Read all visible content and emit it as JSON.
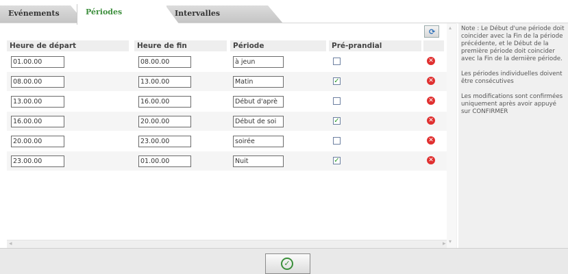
{
  "tabs": [
    {
      "label": "Evénements"
    },
    {
      "label": "Périodes"
    },
    {
      "label": "Intervalles"
    }
  ],
  "columns": {
    "start": "Heure de départ",
    "end": "Heure de fin",
    "period": "Période",
    "preprandial": "Pré-prandial"
  },
  "rows": [
    {
      "start": "01.00.00",
      "end": "08.00.00",
      "period": "à jeun",
      "preprandial": false
    },
    {
      "start": "08.00.00",
      "end": "13.00.00",
      "period": "Matin",
      "preprandial": true
    },
    {
      "start": "13.00.00",
      "end": "16.00.00",
      "period": "Début d'aprè",
      "preprandial": false
    },
    {
      "start": "16.00.00",
      "end": "20.00.00",
      "period": "Début de soi",
      "preprandial": true
    },
    {
      "start": "20.00.00",
      "end": "23.00.00",
      "period": "soirée",
      "preprandial": false
    },
    {
      "start": "23.00.00",
      "end": "01.00.00",
      "period": "Nuit",
      "preprandial": true
    }
  ],
  "note": {
    "p1": "Note : Le Début d'une période doit coincider avec la Fin de la période précédente, et le Début de la première période doit coincider avec la Fin de la dernière période.",
    "p2": "Les périodes individuelles doivent être consécutives",
    "p3": "Les modifications sont confirmées uniquement après avoir appuyé sur CONFIRMER"
  },
  "icons": {
    "refresh": "refresh-icon",
    "delete": "delete-icon",
    "confirm": "confirm-check-icon"
  },
  "colors": {
    "active_tab": "#3d8f3d",
    "delete": "#e03030",
    "check": "#2a9a2a"
  }
}
